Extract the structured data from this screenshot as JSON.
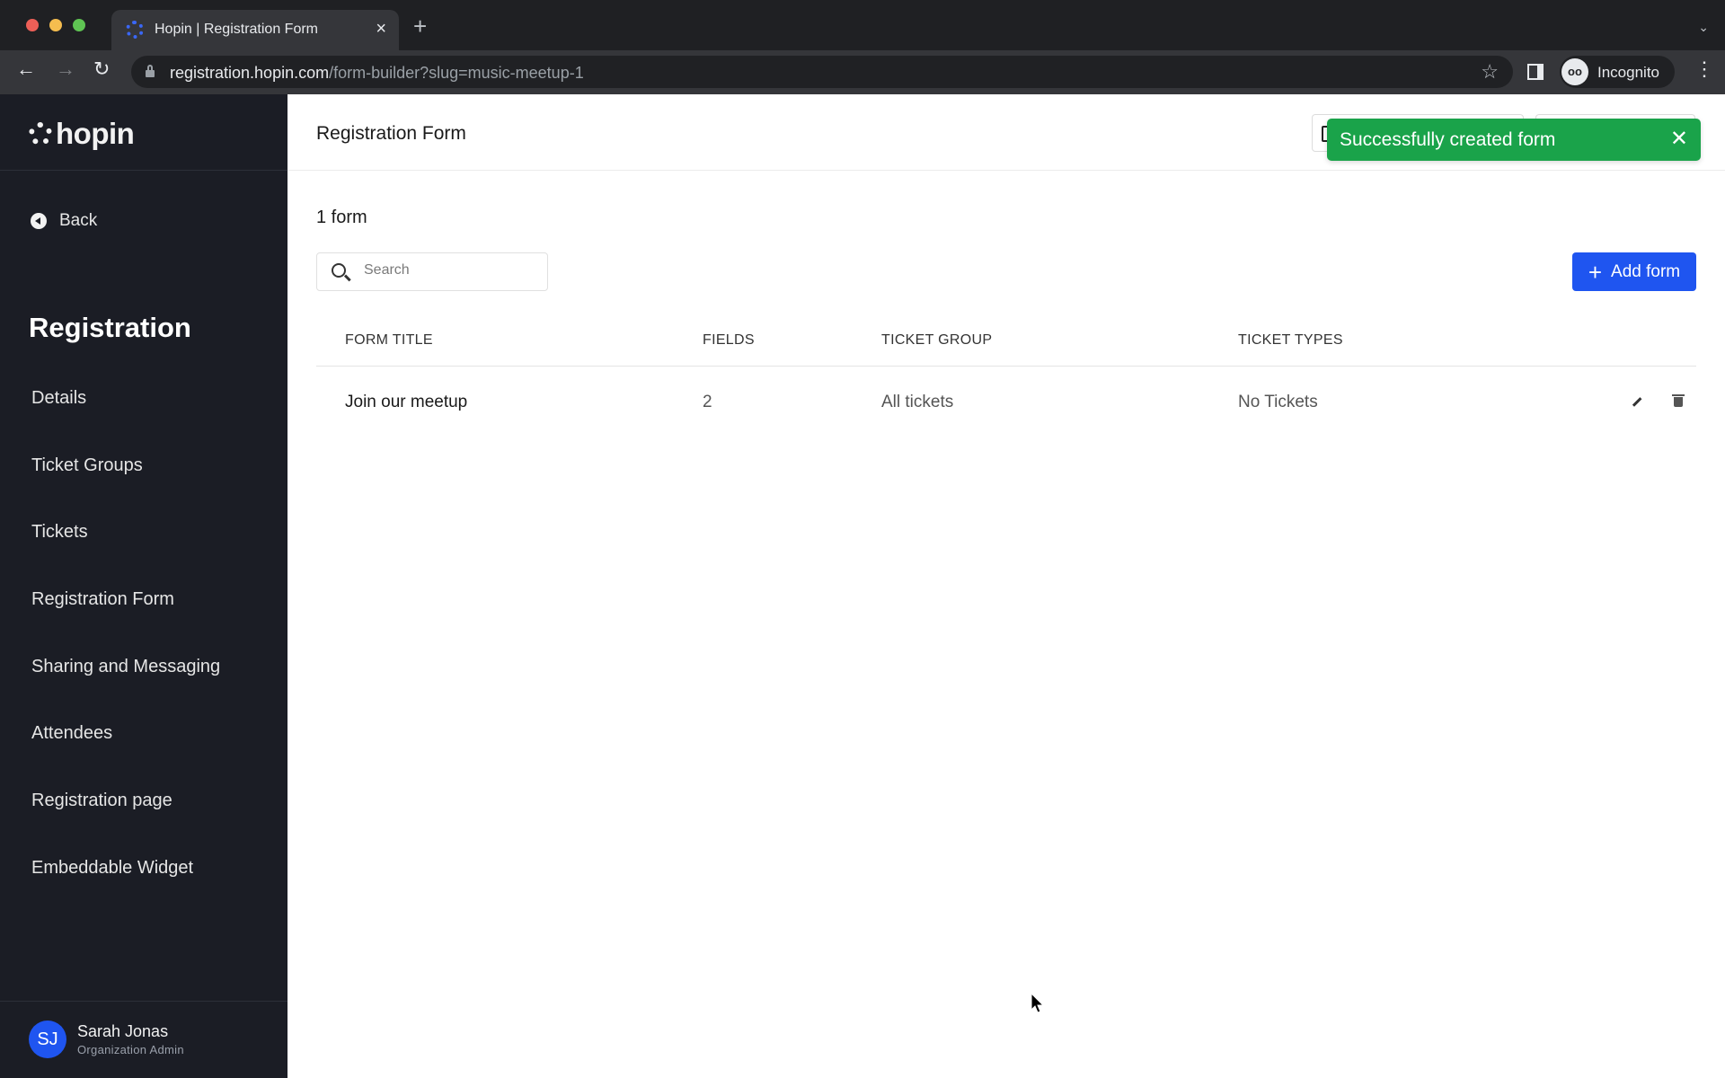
{
  "browser": {
    "tab_title": "Hopin | Registration Form",
    "new_tab_label": "+",
    "url_host": "registration.hopin.com",
    "url_path": "/form-builder?slug=music-meetup-1",
    "profile_label": "Incognito"
  },
  "sidebar": {
    "logo_text": "hopin",
    "back_label": "Back",
    "section_title": "Registration",
    "items": [
      {
        "label": "Details"
      },
      {
        "label": "Ticket Groups"
      },
      {
        "label": "Tickets"
      },
      {
        "label": "Registration Form"
      },
      {
        "label": "Sharing and Messaging"
      },
      {
        "label": "Attendees"
      },
      {
        "label": "Registration page"
      },
      {
        "label": "Embeddable Widget"
      }
    ],
    "user": {
      "initials": "SJ",
      "name": "Sarah Jonas",
      "role": "Organization Admin"
    }
  },
  "header": {
    "title": "Registration Form"
  },
  "toast": {
    "message": "Successfully created form",
    "close": "✕",
    "color": "#1aa34a"
  },
  "main": {
    "count_label": "1 form",
    "search_placeholder": "Search",
    "search_value": "",
    "add_button_label": "Add form",
    "accent_color": "#1f55f0",
    "table": {
      "columns": [
        "FORM TITLE",
        "FIELDS",
        "TICKET GROUP",
        "TICKET TYPES"
      ],
      "rows": [
        {
          "title": "Join our meetup",
          "fields": "2",
          "ticket_group": "All tickets",
          "ticket_types": "No Tickets"
        }
      ]
    }
  }
}
